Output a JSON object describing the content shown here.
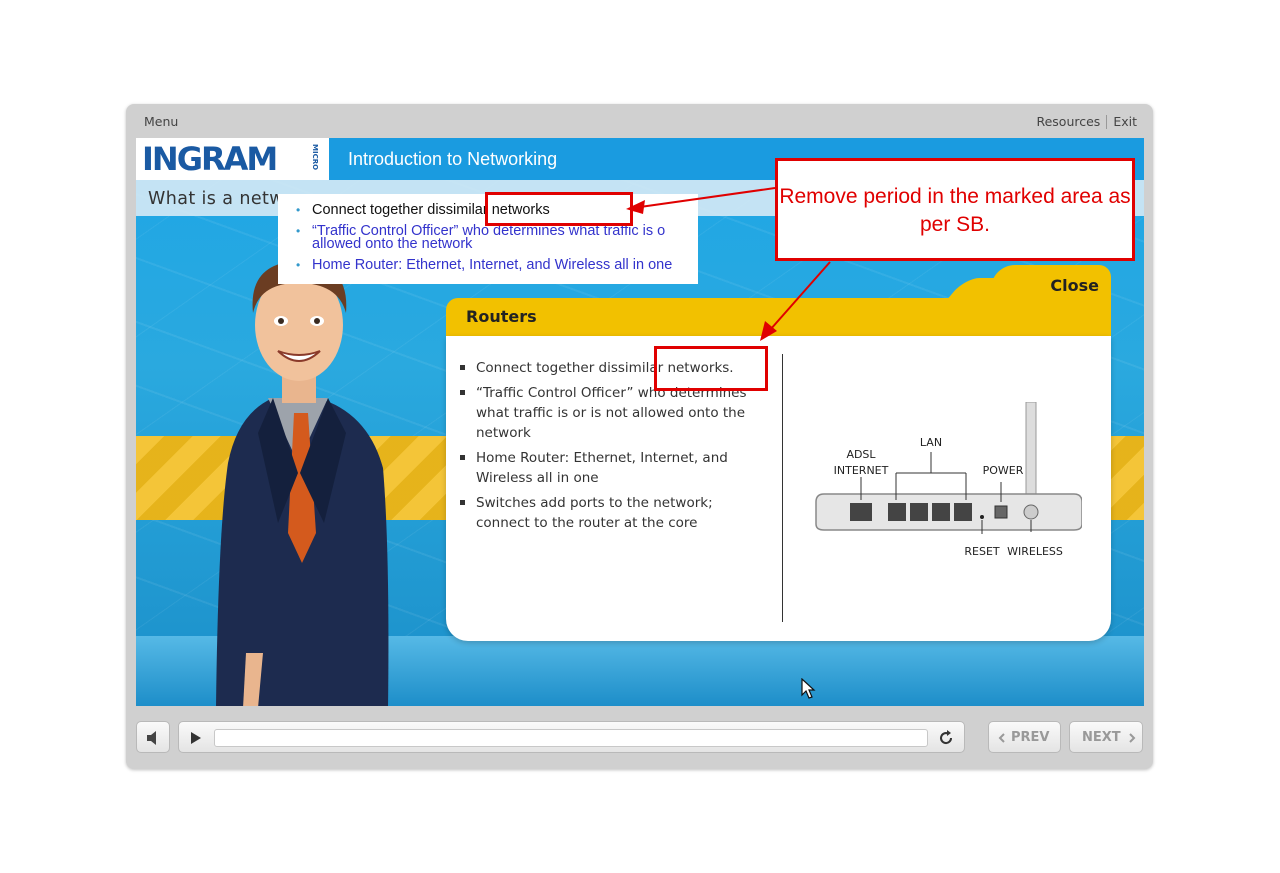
{
  "topbar": {
    "menu_label": "Menu",
    "resources_label": "Resources",
    "exit_label": "Exit"
  },
  "header": {
    "logo_text": "INGRAM",
    "logo_micro": "MICRO",
    "course_title": "Introduction to Networking"
  },
  "slide": {
    "title": "What is a netw"
  },
  "popup": {
    "title": "Routers",
    "close_label": "Close",
    "bullets": [
      "Connect together dissimilar networks.",
      "“Traffic Control Officer” who determines what traffic is or is not allowed onto the network",
      "Home Router: Ethernet, Internet, and Wireless all in one",
      "Switches add ports to the network; connect to the router at the core"
    ],
    "diagram_labels": {
      "adsl": "ADSL",
      "internet": "INTERNET",
      "lan": "LAN",
      "power": "POWER",
      "reset": "RESET",
      "wireless": "WIRELESS"
    }
  },
  "storyboard_panel": {
    "bullets": [
      "Connect together dissimilar networks",
      "“Traffic Control Officer” who determines what traffic is o",
      "allowed onto the network",
      "Home Router: Ethernet, Internet, and Wireless all in one"
    ]
  },
  "annotation": {
    "text": "Remove period in the marked area as per SB."
  },
  "player": {
    "prev_label": "PREV",
    "next_label": "NEXT",
    "progress": 0
  },
  "colors": {
    "brand_blue": "#1a9be0",
    "popup_yellow": "#f2c100",
    "annotation_red": "#e00000"
  }
}
